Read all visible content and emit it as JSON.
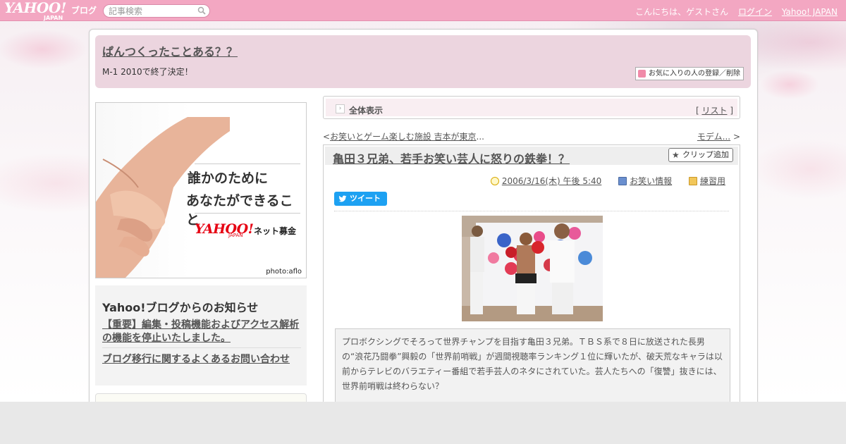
{
  "header": {
    "logo_text": "YAHOO!",
    "logo_sub": "JAPAN",
    "logo_blog": "ブログ",
    "search_placeholder": "記事検索",
    "greeting": "こんにちは、ゲストさん",
    "login_label": "ログイン",
    "yahoo_japan_label": "Yahoo! JAPAN"
  },
  "blog": {
    "title": "ぱんつくったことある？？",
    "description": "M-1 2010で終了決定！",
    "favorite_button": "お気に入りの人の登録／削除"
  },
  "ad": {
    "line1": "誰かのために",
    "line2": "あなたができること",
    "logo": "YAHOO!",
    "logo_sub": "JAPAN",
    "service": "ネット募金",
    "credit": "photo:aflo"
  },
  "notice": {
    "heading": "Yahoo!ブログからのお知らせ",
    "items": [
      "【重要】編集・投稿機能およびアクセス解析の機能を停止いたしました。",
      "ブログ移行に関するよくあるお問い合わせ"
    ]
  },
  "mode_bar": {
    "label": "全体表示",
    "list_open": "[",
    "list_label": "リスト",
    "list_close": "]"
  },
  "pager": {
    "prev_arrow": "<",
    "prev_label": "お笑いとゲーム楽しむ施設 吉本が東京",
    "prev_ellipsis": "...",
    "next_label": "モデム...",
    "next_arrow": ">"
  },
  "article": {
    "title": "亀田３兄弟、若手お笑い芸人に怒りの鉄拳！？",
    "clip_label": "クリップ追加",
    "date": "2006/3/16(木) 午後 5:40",
    "category": "お笑い情報",
    "folder": "練習用",
    "tweet_label": "ツイート",
    "summary": "プロボクシングでそろって世界チャンプを目指す亀田３兄弟。ＴＢＳ系で８日に放送された長男の“浪花乃闘拳”興毅の「世界前哨戦」が週間視聴率ランキング１位に輝いたが、破天荒なキャラは以前からテレビのバラエティー番組で若手芸人のネタにされていた。芸人たちへの「復讐」抜きには、世界前哨戦は終わらない？"
  },
  "colors": {
    "header_pink": "#f3a7c2",
    "blog_head_bg": "#ecd5df",
    "tweet_blue": "#1da1f2",
    "link_gray": "#555555"
  }
}
